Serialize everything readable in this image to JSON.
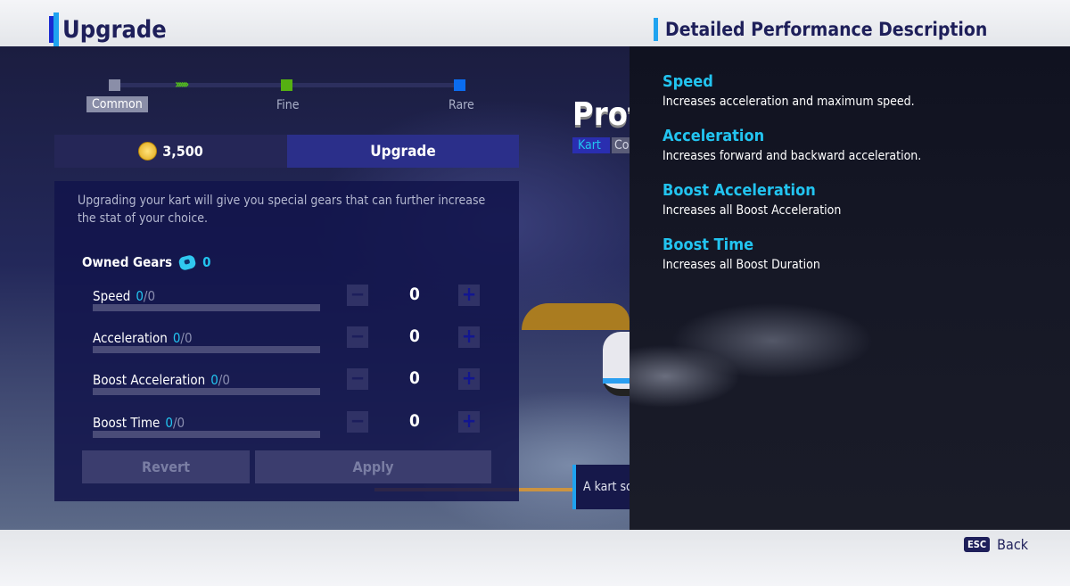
{
  "header": {
    "title": "Upgrade"
  },
  "tiers": [
    {
      "label": "Common",
      "color": "#8a8ea8",
      "selected": true
    },
    {
      "label": "Fine",
      "color": "#55b012"
    },
    {
      "label": "Rare",
      "color": "#0a6cf0"
    }
  ],
  "progress_chevrons": "››››››",
  "upgrade_bar": {
    "cost": "3,500",
    "currency_icon": "coin-icon",
    "button_label": "Upgrade"
  },
  "description": "Upgrading your kart will give you special gears that can further increase the stat of your choice.",
  "owned_gears": {
    "label": "Owned Gears",
    "count": "0",
    "icon": "gear-icon"
  },
  "stats": [
    {
      "label": "Speed",
      "current": "0",
      "max": "/0",
      "value": "0"
    },
    {
      "label": "Acceleration",
      "current": "0",
      "max": "/0",
      "value": "0"
    },
    {
      "label": "Boost Acceleration",
      "current": "0",
      "max": "/0",
      "value": "0"
    },
    {
      "label": "Boost Time",
      "current": "0",
      "max": "/0",
      "value": "0"
    }
  ],
  "buttons": {
    "minus": "−",
    "plus": "+",
    "revert": "Revert",
    "apply": "Apply"
  },
  "kart": {
    "name": "Proto",
    "tag_kart": "Kart",
    "tag_other": "Co",
    "desc": "A kart so"
  },
  "right_panel": {
    "title": "Detailed Performance Description",
    "items": [
      {
        "heading": "Speed",
        "text": "Increases acceleration and maximum speed."
      },
      {
        "heading": "Acceleration",
        "text": "Increases forward and backward acceleration."
      },
      {
        "heading": "Boost Acceleration",
        "text": "Increases all Boost Acceleration"
      },
      {
        "heading": "Boost Time",
        "text": "Increases all Boost Duration"
      }
    ]
  },
  "footer": {
    "key": "ESC",
    "label": "Back"
  }
}
